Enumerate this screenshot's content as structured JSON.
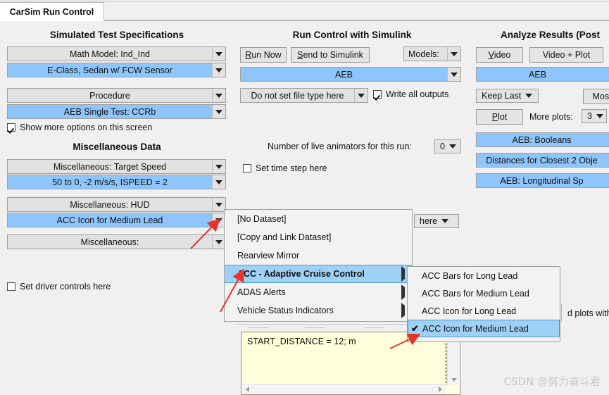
{
  "window": {
    "tab_title": "CarSim Run Control"
  },
  "left_panel": {
    "title": "Simulated Test Specifications",
    "vehicle_group_label": "Math Model: Ind_Ind",
    "vehicle_value": "E-Class, Sedan w/ FCW Sensor",
    "procedure_group_label": "Procedure",
    "procedure_value": "AEB Single Test: CCRb",
    "show_more_options": {
      "label": "Show more options on this screen",
      "checked": true
    },
    "misc_title": "Miscellaneous Data",
    "misc1_group_label": "Miscellaneous: Target Speed",
    "misc1_value": "50 to 0, -2 m/s/s, ISPEED = 2",
    "misc2_group_label": "Miscellaneous: HUD",
    "misc2_value": "ACC Icon for Medium Lead",
    "misc3_group_label": "Miscellaneous:",
    "set_driver_controls": {
      "label": "Set driver controls here",
      "checked": false
    }
  },
  "center_panel": {
    "title": "Run Control with Simulink",
    "run_now_label": "Run Now",
    "run_now_mnemonic": "R",
    "send_to_simulink_label": "Send to Simulink",
    "send_to_simulink_mnemonic": "S",
    "models_label": "Models:",
    "model_value": "AEB",
    "file_type_value": "Do not set file type here",
    "write_all_outputs": {
      "label": "Write all outputs",
      "checked": true
    },
    "animators_label": "Number of live animators for this run:",
    "animators_value": "0",
    "set_time_step": {
      "label": "Set time step here",
      "checked": false
    },
    "hidden_combo_value": "here"
  },
  "right_panel": {
    "title": "Analyze Results (Post",
    "video_label": "Video",
    "video_mnemonic": "V",
    "video_plot_label": "Video + Plot",
    "dataset_value": "AEB",
    "keep_last_label": "Keep Last",
    "most_label": "Most",
    "plot_label": "Plot",
    "plot_mnemonic": "P",
    "more_plots_label": "More plots:",
    "more_plots_value": "3",
    "plot_items": [
      "AEB: Booleans",
      "Distances for Closest 2 Obje",
      "AEB: Longitudinal Sp"
    ],
    "clipped_text": "d plots with"
  },
  "menu": {
    "items": [
      {
        "label": "[No Dataset]",
        "has_submenu": false,
        "highlighted": false
      },
      {
        "label": "[Copy and Link Dataset]",
        "has_submenu": false,
        "highlighted": false
      },
      {
        "label": "Rearview Mirror",
        "has_submenu": false,
        "highlighted": false
      },
      {
        "label": "ACC - Adaptive Cruise Control",
        "has_submenu": true,
        "highlighted": true
      },
      {
        "label": "ADAS Alerts",
        "has_submenu": true,
        "highlighted": false
      },
      {
        "label": "Vehicle Status Indicators",
        "has_submenu": true,
        "highlighted": false
      }
    ],
    "submenu": [
      {
        "label": "ACC Bars for Long Lead",
        "checked": false,
        "highlighted": false
      },
      {
        "label": "ACC Bars for Medium Lead",
        "checked": false,
        "highlighted": false
      },
      {
        "label": "ACC Icon for Long Lead",
        "checked": false,
        "highlighted": false
      },
      {
        "label": "ACC Icon for Medium Lead",
        "checked": true,
        "highlighted": true
      }
    ],
    "check_glyph": "✔"
  },
  "editor": {
    "text": "START_DISTANCE = 12; m"
  },
  "watermark": {
    "text": "CSDN @努力奋斗君"
  },
  "colors": {
    "selection_blue": "#8ec5fb",
    "menu_highlight": "#9fd0f5",
    "menu_highlight_border": "#4a9ad6",
    "editor_yellow": "#ffffdc",
    "annotation_red": "#e8342a",
    "window_bg": "#f0f0f0"
  }
}
